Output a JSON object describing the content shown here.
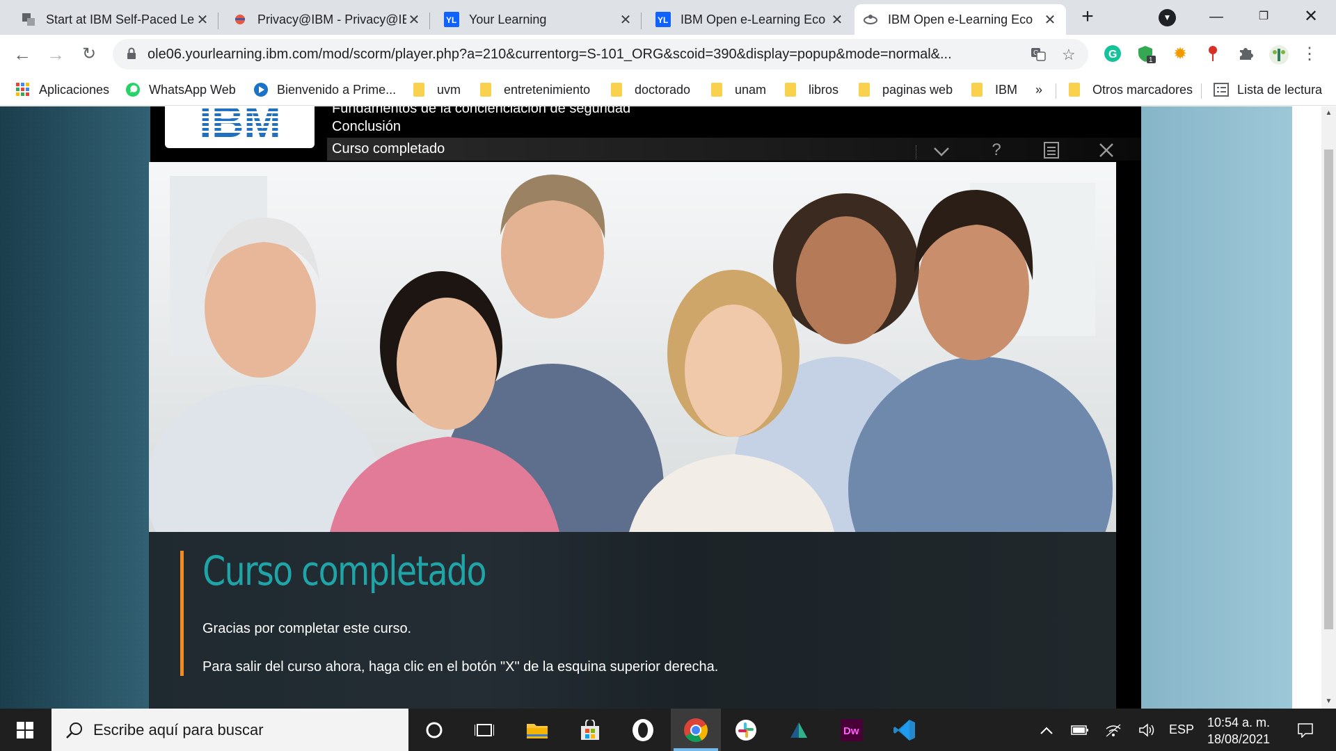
{
  "browser": {
    "tabs": [
      {
        "title": "Start at IBM Self-Paced Le",
        "icon": "page-icon"
      },
      {
        "title": "Privacy@IBM - Privacy@IB",
        "icon": "ibm-bee-icon"
      },
      {
        "title": "Your Learning",
        "icon": "yl-icon"
      },
      {
        "title": "IBM Open e-Learning Eco",
        "icon": "yl-icon"
      },
      {
        "title": "IBM Open e-Learning Eco",
        "icon": "ibm-bee-icon",
        "active": true
      }
    ],
    "url": "ole06.yourlearning.ibm.com/mod/scorm/player.php?a=210&currentorg=S-101_ORG&scoid=390&display=popup&mode=normal&...",
    "bookmarks": [
      {
        "label": "Aplicaciones",
        "icon": "apps-grid-icon"
      },
      {
        "label": "WhatsApp Web",
        "icon": "whatsapp-icon"
      },
      {
        "label": "Bienvenido a Prime...",
        "icon": "prime-video-icon"
      },
      {
        "label": "uvm",
        "icon": "folder-icon"
      },
      {
        "label": "entretenimiento",
        "icon": "folder-icon"
      },
      {
        "label": "doctorado",
        "icon": "folder-icon"
      },
      {
        "label": "unam",
        "icon": "folder-icon"
      },
      {
        "label": "libros",
        "icon": "folder-icon"
      },
      {
        "label": "paginas web",
        "icon": "folder-icon"
      },
      {
        "label": "IBM",
        "icon": "folder-icon"
      }
    ],
    "more_bookmarks": "»",
    "other_bookmarks": "Otros marcadores",
    "reading_list": "Lista de lectura"
  },
  "course": {
    "logo_text": "IBM",
    "course_name": "Fundamentos de la concienciación de seguridad",
    "module_name": "Conclusión",
    "lesson_name": "Curso completado",
    "title": "Curso completado",
    "paragraph_1": "Gracias por completar este curso.",
    "paragraph_2": "Para salir del curso ahora, haga clic en el botón \"X\" de la esquina superior derecha."
  },
  "taskbar": {
    "search_placeholder": "Escribe aquí para buscar",
    "language": "ESP",
    "time": "10:54 a. m.",
    "date": "18/08/2021",
    "apps": [
      "cortana-icon",
      "task-view-icon",
      "file-explorer-icon",
      "store-icon",
      "opera-icon",
      "chrome-icon",
      "slack-icon",
      "app-icon",
      "dreamweaver-icon",
      "vscode-icon"
    ]
  },
  "colors": {
    "accent_orange": "#f28c1e",
    "title_teal": "#1fa5a8",
    "ibm_blue": "#1f70c1"
  }
}
